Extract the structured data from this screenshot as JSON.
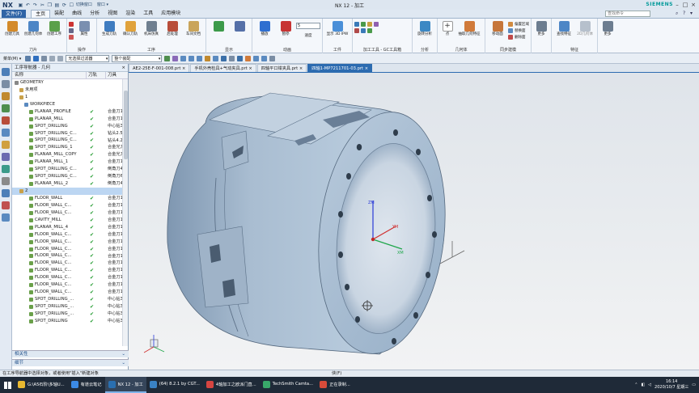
{
  "app": {
    "logo": "NX",
    "window_title": "NX 12 - 加工",
    "brand": "SIEMENS",
    "quick_label": "切换窗口",
    "window_menu": "窗口 ▾"
  },
  "menu": {
    "file": "文件(F)",
    "tabs": [
      "主页",
      "装配",
      "曲线",
      "分析",
      "视图",
      "渲染",
      "工具",
      "应用模块"
    ],
    "active": 0,
    "search_placeholder": "查找命令"
  },
  "ribbon": {
    "groups": [
      {
        "label": "刀片",
        "buttons": [
          "创建刀具",
          "创建几何体",
          "创建工序"
        ]
      },
      {
        "label": "操作",
        "buttons": [
          "属性"
        ]
      },
      {
        "label": "工序",
        "buttons": [
          "生成刀轨",
          "确认刀轨",
          "机床仿真",
          "后处理",
          "车间文档"
        ]
      },
      {
        "label": "显示",
        "buttons": [
          ""
        ],
        "extra": "显示 3D IPW"
      },
      {
        "label": "动画",
        "buttons": [
          "播放",
          "暂停"
        ],
        "speed_value": "5",
        "speed_label": "速度"
      },
      {
        "label": "工件",
        "buttons": [
          "显示 3D IPW"
        ]
      },
      {
        "label": "加工工具 - GC工具箱",
        "buttons": [
          ""
        ]
      },
      {
        "label": "分析",
        "buttons": [
          "旋转分析"
        ]
      },
      {
        "label": "几何体",
        "buttons": [
          "点",
          "抽取几何特征"
        ]
      },
      {
        "label": "同步建模",
        "buttons": [
          "移动面"
        ],
        "small": [
          "偏置区域",
          "替换面",
          "删除面"
        ]
      },
      {
        "label": "",
        "buttons": [
          "更多"
        ]
      },
      {
        "label": "特征",
        "buttons": [
          "查找特征",
          "2D几何体"
        ]
      },
      {
        "label": "",
        "buttons": [
          "更多"
        ]
      }
    ]
  },
  "toolbar2": {
    "menu_label": "菜单(M) ▾",
    "filter": "无选择过滤器",
    "assembly": "整个装配"
  },
  "nav": {
    "title": "工序导航器 - 几何",
    "columns": [
      "名称",
      "刀轨",
      "刀具"
    ],
    "rows": [
      {
        "name": "GEOMETRY",
        "indent": 0,
        "check": false,
        "tool": ""
      },
      {
        "name": "未用项",
        "indent": 1,
        "check": false,
        "tool": ""
      },
      {
        "name": "1",
        "indent": 1,
        "check": false,
        "tool": ""
      },
      {
        "name": "WORKPIECE",
        "indent": 2,
        "check": false,
        "tool": ""
      },
      {
        "name": "PLANAR_PROFILE",
        "indent": 3,
        "check": true,
        "tool": "合金刀1"
      },
      {
        "name": "PLANAR_MILL",
        "indent": 3,
        "check": true,
        "tool": "合金刀1"
      },
      {
        "name": "SPOT_DRILLING",
        "indent": 3,
        "check": true,
        "tool": "中心钻3"
      },
      {
        "name": "SPOT_DRILLING_C...",
        "indent": 3,
        "check": true,
        "tool": "钻头2.5"
      },
      {
        "name": "SPOT_DRILLING_C...",
        "indent": 3,
        "check": true,
        "tool": "钻头4.2"
      },
      {
        "name": "SPOT_DRILLING_1",
        "indent": 3,
        "check": true,
        "tool": "合金光刀"
      },
      {
        "name": "PLANAR_MILL_COPY",
        "indent": 3,
        "check": true,
        "tool": "合金光刀"
      },
      {
        "name": "PLANAR_MILL_1",
        "indent": 3,
        "check": true,
        "tool": "合金刀1"
      },
      {
        "name": "SPOT_DRILLING_C...",
        "indent": 3,
        "check": true,
        "tool": "倒角刀4"
      },
      {
        "name": "SPOT_DRILLING_C...",
        "indent": 3,
        "check": true,
        "tool": "倒角刀6"
      },
      {
        "name": "PLANAR_MILL_2",
        "indent": 3,
        "check": true,
        "tool": "倒角刀4"
      },
      {
        "name": "2",
        "indent": 1,
        "check": false,
        "tool": "",
        "selected": true
      },
      {
        "name": "FLOOR_WALL",
        "indent": 3,
        "check": true,
        "tool": "合金刀1"
      },
      {
        "name": "FLOOR_WALL_C...",
        "indent": 3,
        "check": true,
        "tool": "合金刀1"
      },
      {
        "name": "FLOOR_WALL_C...",
        "indent": 3,
        "check": true,
        "tool": "合金刀1"
      },
      {
        "name": "CAVITY_MILL",
        "indent": 3,
        "check": true,
        "tool": "合金刀1"
      },
      {
        "name": "PLANAR_MILL_4",
        "indent": 3,
        "check": true,
        "tool": "合金刀1"
      },
      {
        "name": "FLOOR_WALL_C...",
        "indent": 3,
        "check": true,
        "tool": "合金刀1"
      },
      {
        "name": "FLOOR_WALL_C...",
        "indent": 3,
        "check": true,
        "tool": "合金刀1"
      },
      {
        "name": "FLOOR_WALL_C...",
        "indent": 3,
        "check": true,
        "tool": "合金刀1"
      },
      {
        "name": "FLOOR_WALL_C...",
        "indent": 3,
        "check": true,
        "tool": "合金刀1"
      },
      {
        "name": "FLOOR_WALL_C...",
        "indent": 3,
        "check": true,
        "tool": "合金刀1"
      },
      {
        "name": "FLOOR_WALL_C...",
        "indent": 3,
        "check": true,
        "tool": "合金刀1"
      },
      {
        "name": "FLOOR_WALL_C...",
        "indent": 3,
        "check": true,
        "tool": "合金刀1"
      },
      {
        "name": "FLOOR_WALL_C...",
        "indent": 3,
        "check": true,
        "tool": "合金刀1"
      },
      {
        "name": "FLOOR_WALL_C...",
        "indent": 3,
        "check": true,
        "tool": "合金刀1"
      },
      {
        "name": "SPOT_DRILLING_...",
        "indent": 3,
        "check": true,
        "tool": "中心钻3"
      },
      {
        "name": "SPOT_DRILLING_...",
        "indent": 3,
        "check": true,
        "tool": "中心钻3"
      },
      {
        "name": "SPOT_DRILLING_...",
        "indent": 3,
        "check": true,
        "tool": "中心钻3"
      },
      {
        "name": "SPOT_DRILLING",
        "indent": 3,
        "check": true,
        "tool": "中心钻3"
      }
    ],
    "sections": [
      "相关性",
      "细节"
    ]
  },
  "doc_tabs": [
    {
      "label": "AE2-25E-F-001-008.prt",
      "active": false
    },
    {
      "label": "手机外壳检具+气动夹具.prt",
      "active": false
    },
    {
      "label": "四轴平口钳夹具.prt",
      "active": false
    },
    {
      "label": "四轴1-MP7211701-03.prt",
      "active": true
    }
  ],
  "viewport": {
    "axis_labels": {
      "x": "XM",
      "y": "YM",
      "z": "ZM"
    }
  },
  "status": {
    "left": "在工序导航器中选择对象，或者使用\"插入\"新建对象",
    "mid": "侠(F)"
  },
  "taskbar": {
    "items": [
      {
        "label": "G:\\A5石阶\\多轴U...",
        "color": "#e8b830"
      },
      {
        "label": "有道云笔记",
        "color": "#3b8ae6"
      },
      {
        "label": "NX 12 - 加工",
        "color": "#2a6fb0",
        "active": true
      },
      {
        "label": "(64) 8.2.1 by CGT...",
        "color": "#3a82c4"
      },
      {
        "label": "4轴加工之欧派门直...",
        "color": "#d64541"
      },
      {
        "label": "TechSmith Camta...",
        "color": "#39a86a"
      },
      {
        "label": "正在录制...",
        "color": "#d84b3a"
      }
    ],
    "time": "16:14",
    "date": "2020/10/7 星期三"
  }
}
